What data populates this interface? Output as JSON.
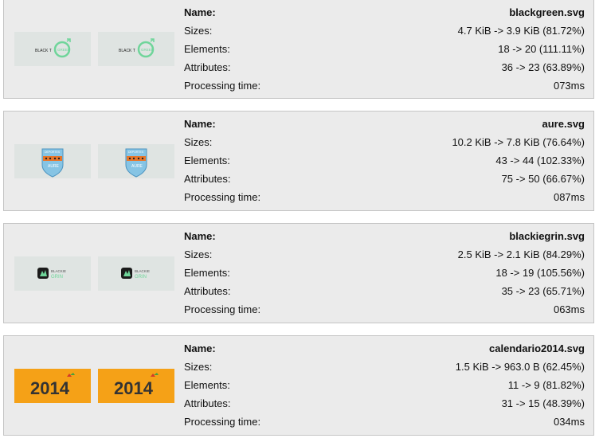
{
  "labels": {
    "name": "Name:",
    "sizes": "Sizes:",
    "elements": "Elements:",
    "attributes": "Attributes:",
    "processing_time": "Processing time:"
  },
  "files": [
    {
      "name": "blackgreen.svg",
      "sizes": "4.7 KiB -> 3.9 KiB (81.72%)",
      "elements": "18 -> 20 (111.11%)",
      "attributes": "36 -> 23 (63.89%)",
      "processing_time": "073ms",
      "logo_text": [
        "BLACK T",
        "GREEN"
      ]
    },
    {
      "name": "aure.svg",
      "sizes": "10.2 KiB -> 7.8 KiB (76.64%)",
      "elements": "43 -> 44 (102.33%)",
      "attributes": "75 -> 50 (66.67%)",
      "processing_time": "087ms",
      "logo_text": [
        "DEPORTES",
        "AURE"
      ]
    },
    {
      "name": "blackiegrin.svg",
      "sizes": "2.5 KiB -> 2.1 KiB (84.29%)",
      "elements": "18 -> 19 (105.56%)",
      "attributes": "35 -> 23 (65.71%)",
      "processing_time": "063ms",
      "logo_text": [
        "BLACKIE",
        "GRIN"
      ]
    },
    {
      "name": "calendario2014.svg",
      "sizes": "1.5 KiB -> 963.0 B (62.45%)",
      "elements": "11 -> 9 (81.82%)",
      "attributes": "31 -> 15 (48.39%)",
      "processing_time": "034ms",
      "logo_text": [
        "2014"
      ]
    }
  ],
  "colors": {
    "card_bg": "#ebebeb",
    "card_border": "#c4c4c4",
    "thumb_bg": "#dfe4e2",
    "calendar_bg": "#f5a117",
    "green": "#6fd59a",
    "aure_blue": "#86c4e4",
    "aure_orange": "#e8762a"
  }
}
